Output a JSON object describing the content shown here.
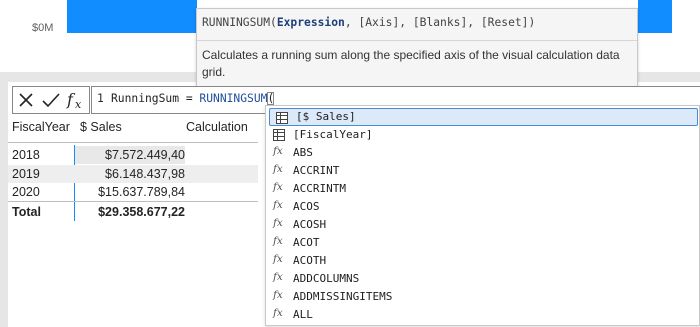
{
  "chart": {
    "axis_label": "$0M",
    "bar_color": "#118dff"
  },
  "tooltip": {
    "signature": {
      "name": "RUNNINGSUM(",
      "param_active": "Expression",
      "rest": ", [Axis], [Blanks], [Reset])"
    },
    "description": "Calculates a running sum along the specified axis of the visual calculation data grid."
  },
  "formula_bar": {
    "line_number": "1",
    "code_prefix": "RunningSum = ",
    "function": "RUNNINGSUM",
    "paren": "("
  },
  "table": {
    "headers": [
      "FiscalYear",
      "$ Sales",
      "Calculation"
    ],
    "rows": [
      {
        "year": "2018",
        "sales": "$7.572.449,40"
      },
      {
        "year": "2019",
        "sales": "$6.148.437,98"
      },
      {
        "year": "2020",
        "sales": "$15.637.789,84"
      }
    ],
    "total": {
      "label": "Total",
      "sales": "$29.358.677,22"
    }
  },
  "suggestions": [
    {
      "kind": "column",
      "label": "[$ Sales]",
      "selected": true
    },
    {
      "kind": "column",
      "label": "[FiscalYear]"
    },
    {
      "kind": "function",
      "label": "ABS"
    },
    {
      "kind": "function",
      "label": "ACCRINT"
    },
    {
      "kind": "function",
      "label": "ACCRINTM"
    },
    {
      "kind": "function",
      "label": "ACOS"
    },
    {
      "kind": "function",
      "label": "ACOSH"
    },
    {
      "kind": "function",
      "label": "ACOT"
    },
    {
      "kind": "function",
      "label": "ACOTH"
    },
    {
      "kind": "function",
      "label": "ADDCOLUMNS"
    },
    {
      "kind": "function",
      "label": "ADDMISSINGITEMS"
    },
    {
      "kind": "function",
      "label": "ALL"
    }
  ],
  "function_icon_glyph": "fx",
  "colors": {
    "accent": "#118dff",
    "selection_bg": "#dbe9f9",
    "selection_border": "#4c8ad4",
    "function_blue": "#1f4e9c"
  }
}
